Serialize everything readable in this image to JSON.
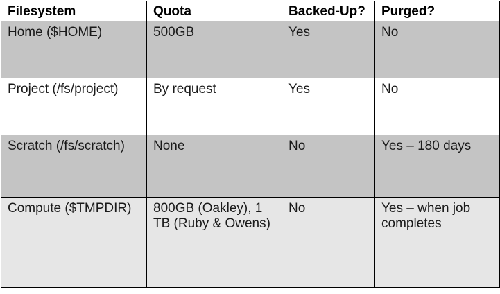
{
  "table": {
    "headers": [
      "Filesystem",
      "Quota",
      "Backed-Up?",
      "Purged?"
    ],
    "rows": [
      [
        "Home ($HOME)",
        "500GB",
        "Yes",
        "No"
      ],
      [
        "Project (/fs/project)",
        "By request",
        "Yes",
        "No"
      ],
      [
        "Scratch (/fs/scratch)",
        "None",
        "No",
        "Yes – 180 days"
      ],
      [
        "Compute ($TMPDIR)",
        "800GB (Oakley), 1 TB (Ruby & Owens)",
        "No",
        "Yes – when job completes"
      ]
    ],
    "colors": {
      "border": "#000000",
      "header_bg": "#ffffff",
      "row_dark": "#c4c4c4",
      "row_light": "#e6e6e6",
      "row_white": "#ffffff"
    }
  }
}
